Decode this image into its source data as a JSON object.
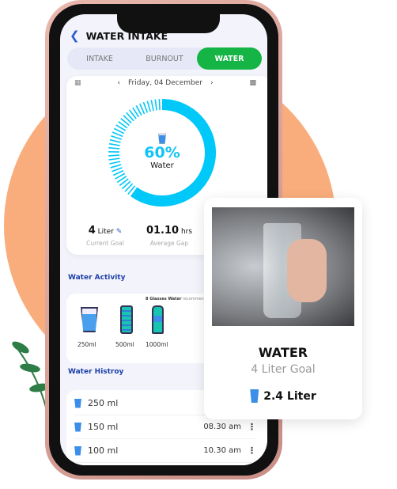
{
  "header": {
    "title": "WATER INTAKE",
    "back_icon": "chevron-left-icon"
  },
  "tabs": [
    {
      "label": "INTAKE",
      "active": false
    },
    {
      "label": "BURNOUT",
      "active": false
    },
    {
      "label": "WATER",
      "active": true
    }
  ],
  "date": {
    "label": "Friday, 04 December"
  },
  "progress": {
    "percent": 60,
    "percent_label": "60%",
    "label": "Water"
  },
  "stats": [
    {
      "value": "4",
      "unit": "Liter",
      "label": "Current Goal"
    },
    {
      "value": "01.10",
      "unit": "hrs",
      "label": "Average Gap"
    }
  ],
  "activity": {
    "title": "Water Activity",
    "note_bold": "8 Glasses Water",
    "note": " recommended",
    "items": [
      {
        "label": "250ml",
        "icon": "glass-icon"
      },
      {
        "label": "500ml",
        "icon": "bottle-icon"
      },
      {
        "label": "1000ml",
        "icon": "large-bottle-icon"
      }
    ]
  },
  "history": {
    "title": "Water Histroy",
    "rows": [
      {
        "amount": "250 ml",
        "time": ""
      },
      {
        "amount": "150 ml",
        "time": "08.30 am"
      },
      {
        "amount": "100 ml",
        "time": "10.30 am"
      }
    ]
  },
  "water_card": {
    "title": "WATER",
    "goal": "4 Liter Goal",
    "amount": "2.4 Liter"
  },
  "colors": {
    "accent": "#14b544",
    "ring": "#00c8f8",
    "blob": "#f9ad7c",
    "section": "#1d3fa8"
  }
}
